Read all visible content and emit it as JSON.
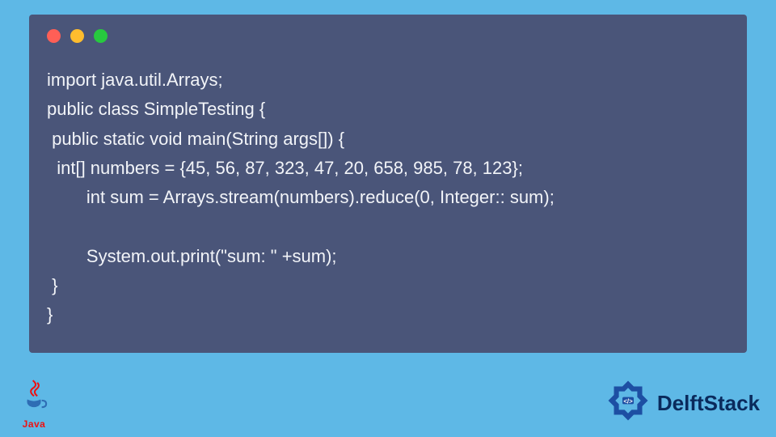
{
  "code": {
    "lines": [
      "import java.util.Arrays;",
      "public class SimpleTesting {",
      " public static void main(String args[]) {",
      "  int[] numbers = {45, 56, 87, 323, 47, 20, 658, 985, 78, 123};",
      "        int sum = Arrays.stream(numbers).reduce(0, Integer:: sum);",
      "",
      "        System.out.print(\"sum: \" +sum);",
      " }",
      "}"
    ]
  },
  "footer": {
    "java_label": "Java",
    "brand": "DelftStack"
  },
  "colors": {
    "page_bg": "#5eb8e6",
    "window_bg": "#4a5579",
    "code_fg": "#f2f4f8",
    "dot_red": "#ff5f56",
    "dot_yellow": "#ffbd2e",
    "dot_green": "#27c93f",
    "brand_fg": "#0a2a5c"
  }
}
